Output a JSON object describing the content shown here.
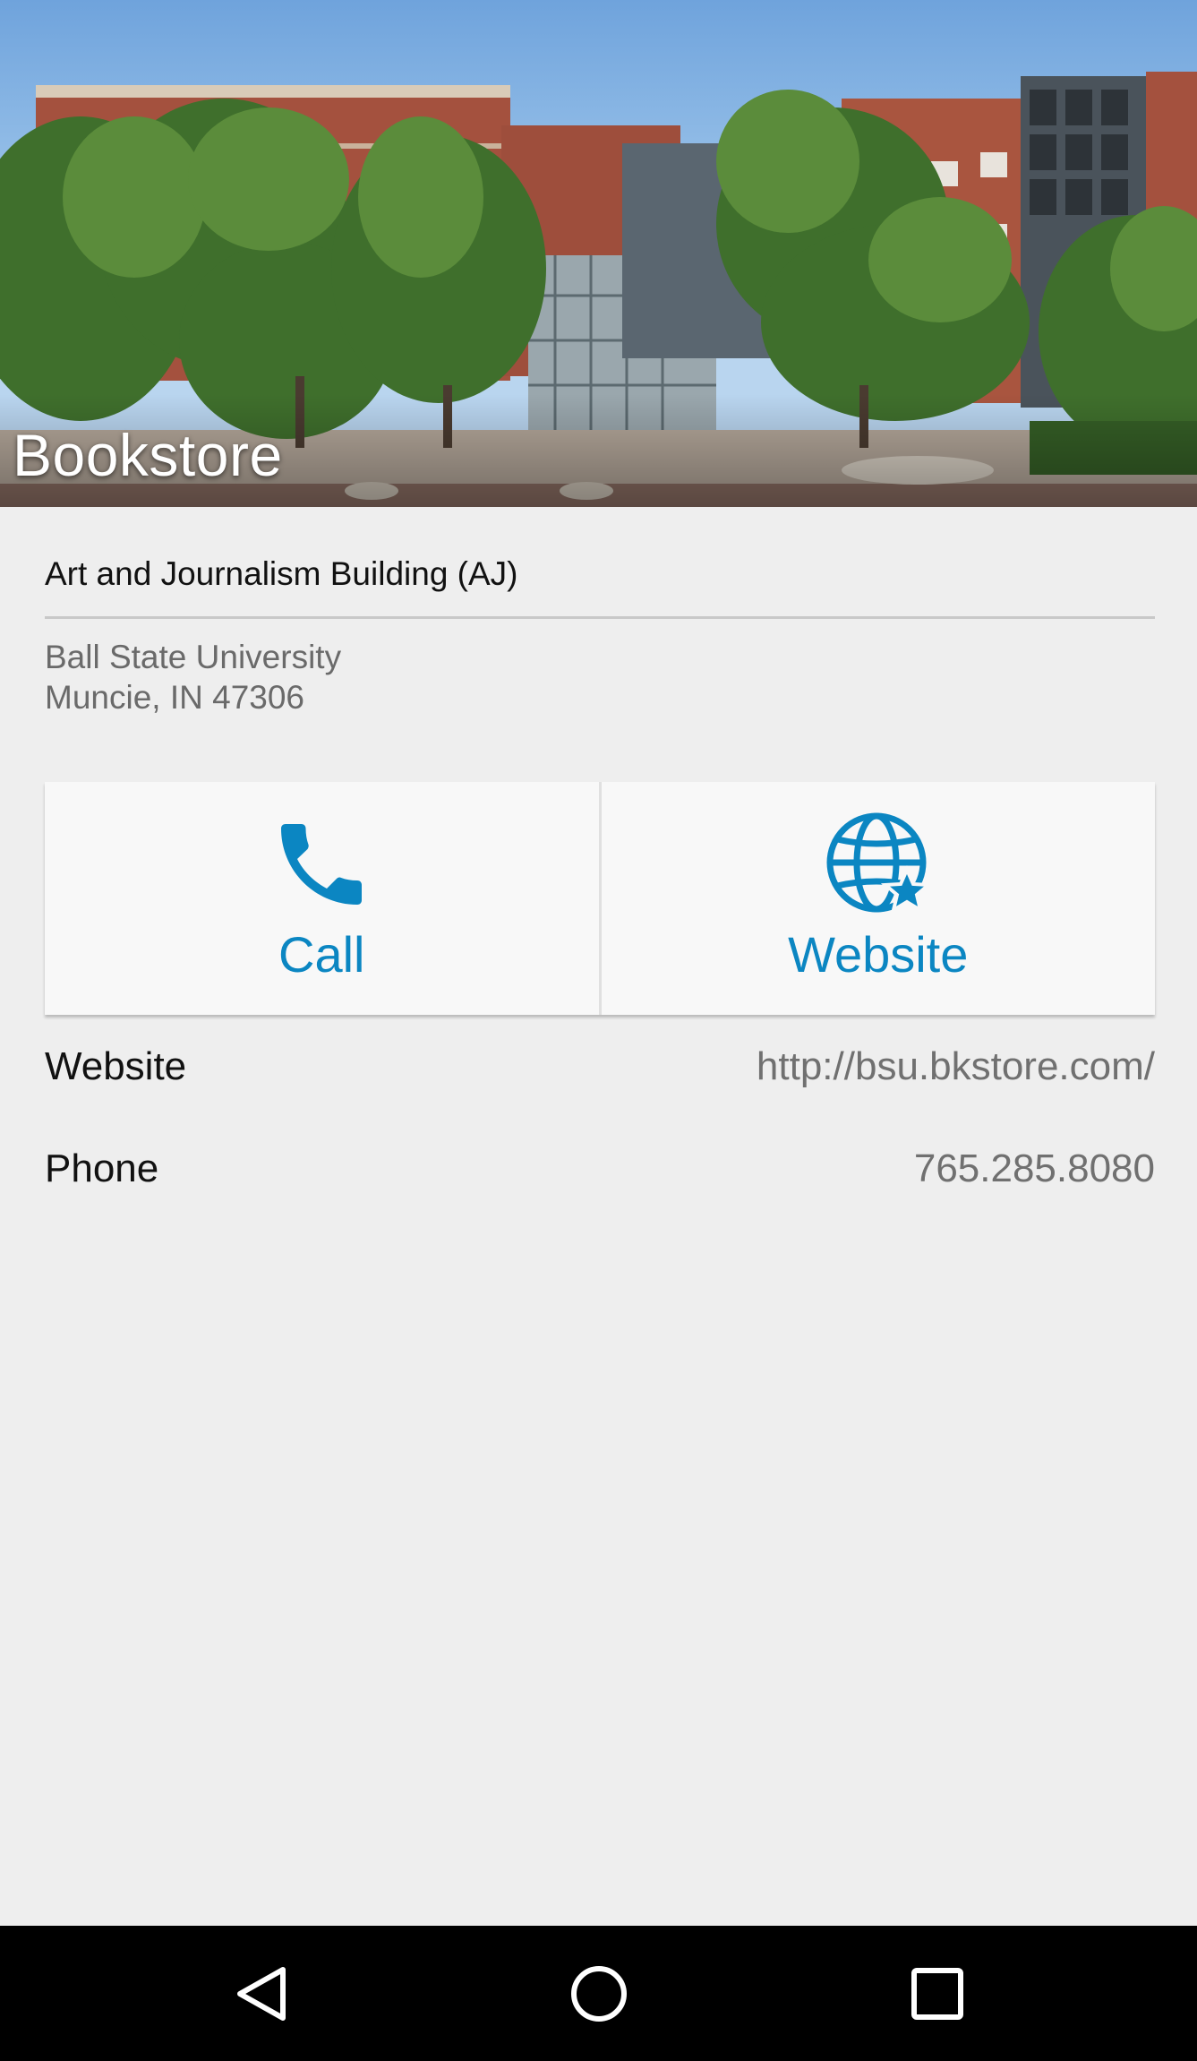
{
  "header": {
    "title": "Bookstore"
  },
  "location": {
    "building": "Art and Journalism Building (AJ)",
    "address_line1": "Ball State University",
    "address_line2": "Muncie, IN 47306"
  },
  "actions": [
    {
      "label": "Call",
      "icon": "phone-icon"
    },
    {
      "label": "Website",
      "icon": "globe-star-icon"
    }
  ],
  "details": [
    {
      "key": "Website",
      "value": "http://bsu.bkstore.com/"
    },
    {
      "key": "Phone",
      "value": "765.285.8080"
    }
  ],
  "colors": {
    "accent": "#0b86c2",
    "background": "#eeeeee",
    "card": "#f8f8f8"
  },
  "navbar": {
    "icons": [
      "back-icon",
      "home-icon",
      "recents-icon"
    ]
  }
}
